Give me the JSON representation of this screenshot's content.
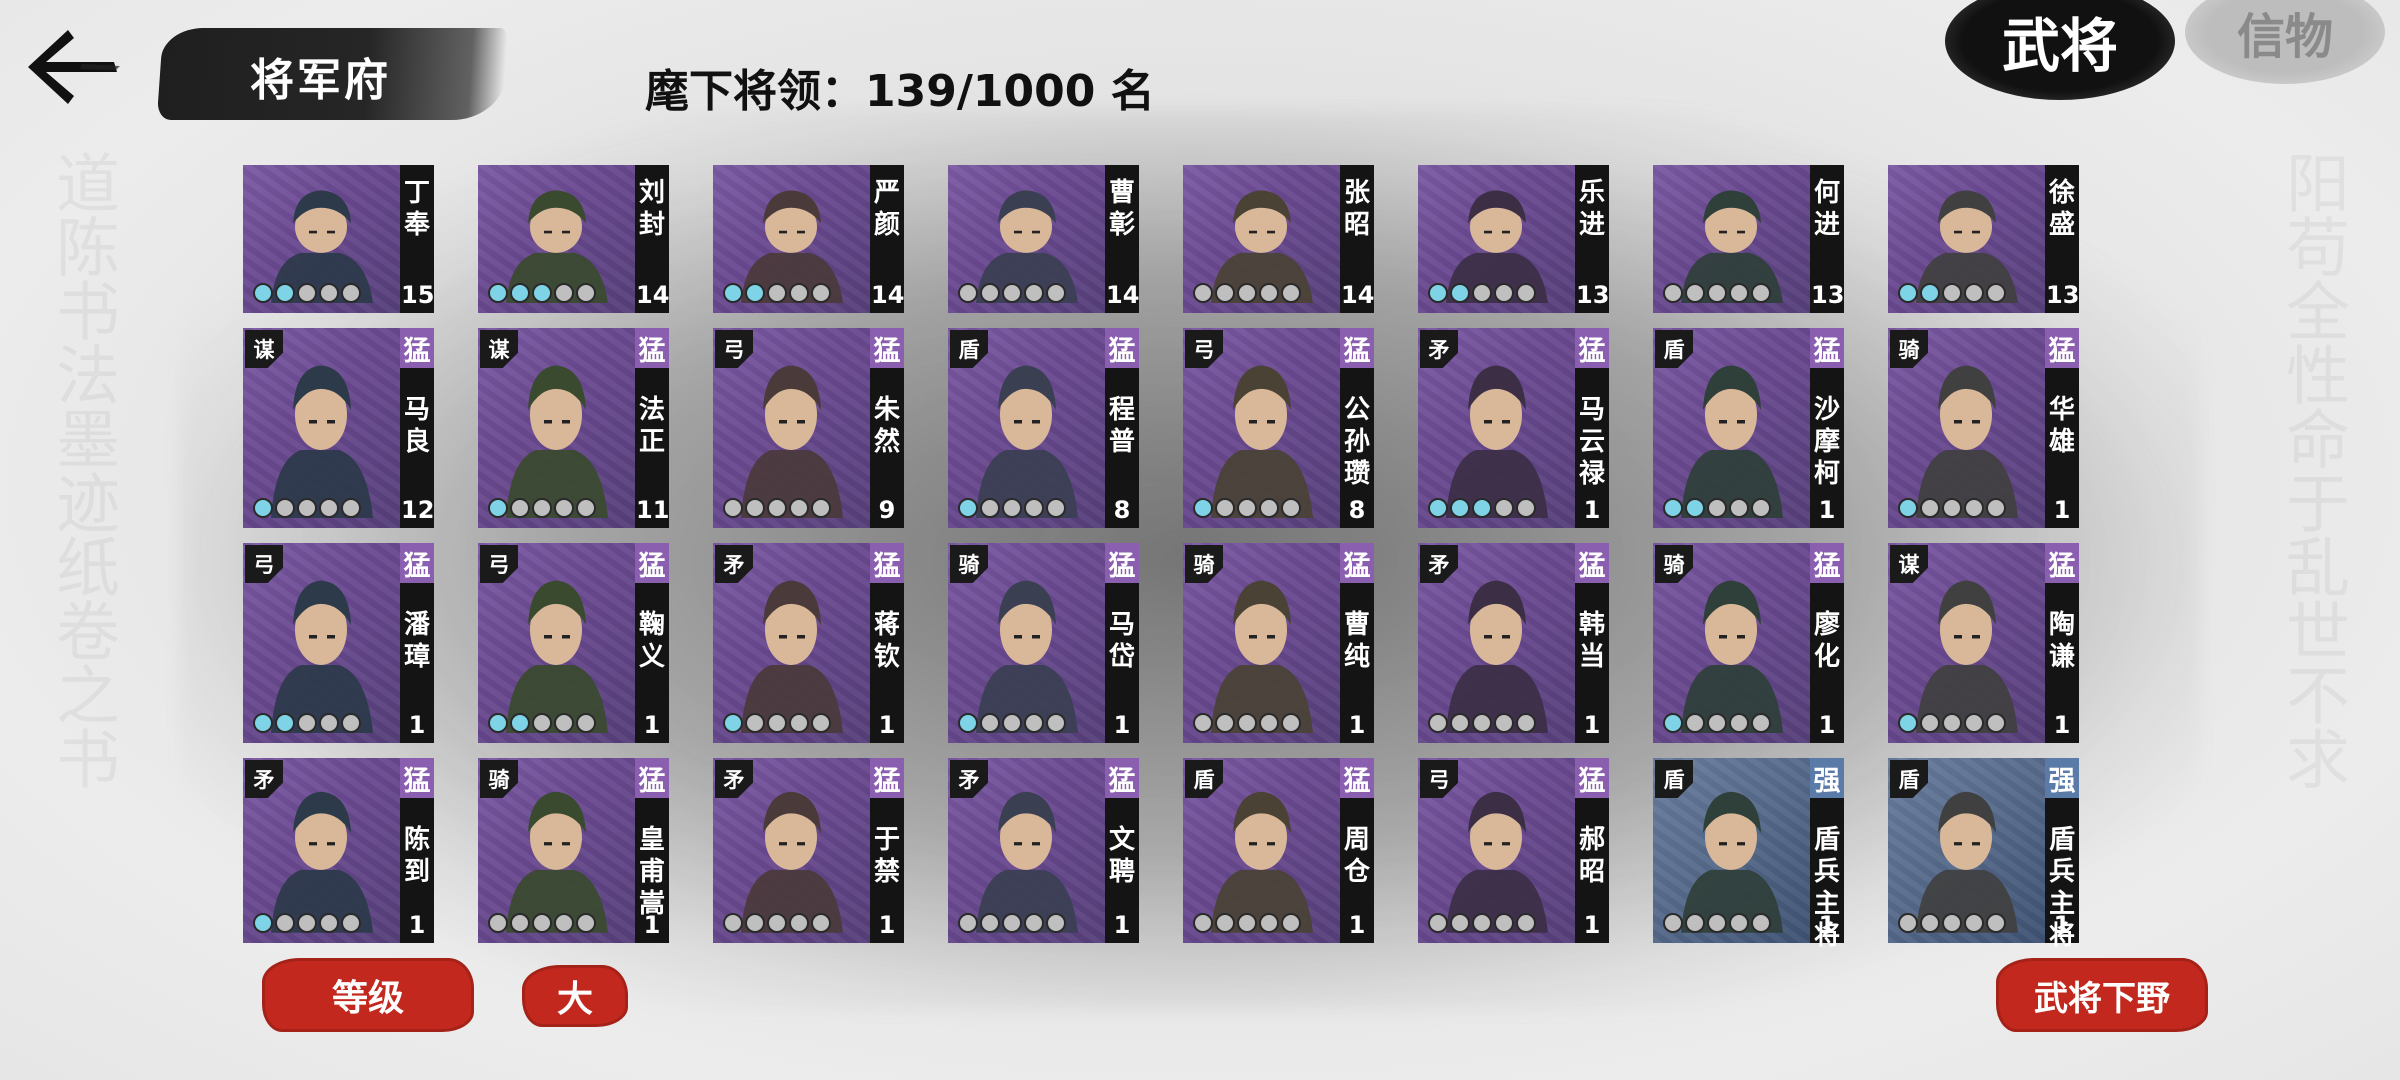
{
  "header": {
    "title": "将军府",
    "general_count_label": "麾下将领：139/1000 名",
    "tabs": [
      {
        "label": "武将",
        "active": true
      },
      {
        "label": "信物",
        "active": false
      }
    ]
  },
  "colors": {
    "purple_card": "#6b4a92",
    "blue_card": "#55698a",
    "elite_badge": "#8b5fb0",
    "red_button": "#c2281d",
    "star_on": "#7fd3e6"
  },
  "generals": [
    [
      {
        "name": "丁奉",
        "level": "15",
        "troop": "",
        "elite": "",
        "stars": 2,
        "color": "purple"
      },
      {
        "name": "刘封",
        "level": "14",
        "troop": "",
        "elite": "",
        "stars": 3,
        "color": "purple"
      },
      {
        "name": "严颜",
        "level": "14",
        "troop": "",
        "elite": "",
        "stars": 2,
        "color": "purple"
      },
      {
        "name": "曹彰",
        "level": "14",
        "troop": "",
        "elite": "",
        "stars": 0,
        "color": "purple"
      },
      {
        "name": "张昭",
        "level": "14",
        "troop": "",
        "elite": "",
        "stars": 0,
        "color": "purple"
      },
      {
        "name": "乐进",
        "level": "13",
        "troop": "",
        "elite": "",
        "stars": 2,
        "color": "purple"
      },
      {
        "name": "何进",
        "level": "13",
        "troop": "",
        "elite": "",
        "stars": 0,
        "color": "purple"
      },
      {
        "name": "徐盛",
        "level": "13",
        "troop": "",
        "elite": "",
        "stars": 2,
        "color": "purple"
      }
    ],
    [
      {
        "name": "马良",
        "level": "12",
        "troop": "谋",
        "elite": "猛",
        "stars": 1,
        "color": "purple"
      },
      {
        "name": "法正",
        "level": "11",
        "troop": "谋",
        "elite": "猛",
        "stars": 1,
        "color": "purple"
      },
      {
        "name": "朱然",
        "level": "9",
        "troop": "弓",
        "elite": "猛",
        "stars": 0,
        "color": "purple"
      },
      {
        "name": "程普",
        "level": "8",
        "troop": "盾",
        "elite": "猛",
        "stars": 1,
        "color": "purple"
      },
      {
        "name": "公孙瓒",
        "level": "8",
        "troop": "弓",
        "elite": "猛",
        "stars": 1,
        "color": "purple"
      },
      {
        "name": "马云禄",
        "level": "1",
        "troop": "矛",
        "elite": "猛",
        "stars": 3,
        "color": "purple"
      },
      {
        "name": "沙摩柯",
        "level": "1",
        "troop": "盾",
        "elite": "猛",
        "stars": 2,
        "color": "purple"
      },
      {
        "name": "华雄",
        "level": "1",
        "troop": "骑",
        "elite": "猛",
        "stars": 1,
        "color": "purple"
      }
    ],
    [
      {
        "name": "潘璋",
        "level": "1",
        "troop": "弓",
        "elite": "猛",
        "stars": 2,
        "color": "purple"
      },
      {
        "name": "鞠义",
        "level": "1",
        "troop": "弓",
        "elite": "猛",
        "stars": 2,
        "color": "purple"
      },
      {
        "name": "蒋钦",
        "level": "1",
        "troop": "矛",
        "elite": "猛",
        "stars": 1,
        "color": "purple"
      },
      {
        "name": "马岱",
        "level": "1",
        "troop": "骑",
        "elite": "猛",
        "stars": 1,
        "color": "purple"
      },
      {
        "name": "曹纯",
        "level": "1",
        "troop": "骑",
        "elite": "猛",
        "stars": 0,
        "color": "purple"
      },
      {
        "name": "韩当",
        "level": "1",
        "troop": "矛",
        "elite": "猛",
        "stars": 0,
        "color": "purple"
      },
      {
        "name": "廖化",
        "level": "1",
        "troop": "骑",
        "elite": "猛",
        "stars": 1,
        "color": "purple"
      },
      {
        "name": "陶谦",
        "level": "1",
        "troop": "谋",
        "elite": "猛",
        "stars": 1,
        "color": "purple"
      }
    ],
    [
      {
        "name": "陈到",
        "level": "1",
        "troop": "矛",
        "elite": "猛",
        "stars": 1,
        "color": "purple"
      },
      {
        "name": "皇甫嵩",
        "level": "1",
        "troop": "骑",
        "elite": "猛",
        "stars": 0,
        "color": "purple"
      },
      {
        "name": "于禁",
        "level": "1",
        "troop": "矛",
        "elite": "猛",
        "stars": 0,
        "color": "purple"
      },
      {
        "name": "文聘",
        "level": "1",
        "troop": "矛",
        "elite": "猛",
        "stars": 0,
        "color": "purple"
      },
      {
        "name": "周仓",
        "level": "1",
        "troop": "盾",
        "elite": "猛",
        "stars": 0,
        "color": "purple"
      },
      {
        "name": "郝昭",
        "level": "1",
        "troop": "弓",
        "elite": "猛",
        "stars": 0,
        "color": "purple"
      },
      {
        "name": "盾兵主将",
        "level": "1",
        "troop": "盾",
        "elite": "强",
        "stars": 0,
        "color": "blue"
      },
      {
        "name": "盾兵主将",
        "level": "1",
        "troop": "盾",
        "elite": "强",
        "stars": 0,
        "color": "blue"
      }
    ]
  ],
  "footer": {
    "sort_level_label": "等级",
    "sort_order_label": "大",
    "release_label": "武将下野"
  }
}
